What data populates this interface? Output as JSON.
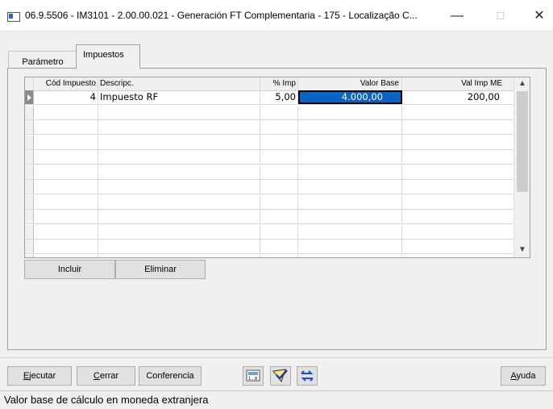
{
  "window": {
    "title": "06.9.5506 - IM3101 - 2.00.00.021 - Generación FT Complementaria - 175 - Localização C...",
    "minimize": "—",
    "maximize": "☐",
    "close": "✕"
  },
  "tabs": [
    {
      "label": "Parámetro",
      "active": false
    },
    {
      "label": "Impuestos",
      "active": true
    }
  ],
  "grid": {
    "columns": [
      "Cód Impuesto",
      "Descripc.",
      "% Imp",
      "Valor Base",
      "Val Imp ME"
    ],
    "rows": [
      {
        "cod": "4",
        "descripcion": "Impuesto RF",
        "pct": "5,00",
        "valor_base": "4.000,00",
        "val_imp_me": "200,00"
      }
    ],
    "scroll_up": "▲",
    "scroll_down": "▼"
  },
  "grid_buttons": {
    "incluir": "Incluir",
    "eliminar": "Eliminar"
  },
  "footer": {
    "ejecutar_label": "Ejecutar",
    "cerrar_label": "Cerrar",
    "conferencia_label": "Conferencia",
    "ayuda_label": "Ayuda"
  },
  "status": {
    "text": "Valor base de cálculo en moneda extranjera"
  },
  "icons": [
    "calculator-icon",
    "check-icon",
    "refresh-icon"
  ]
}
